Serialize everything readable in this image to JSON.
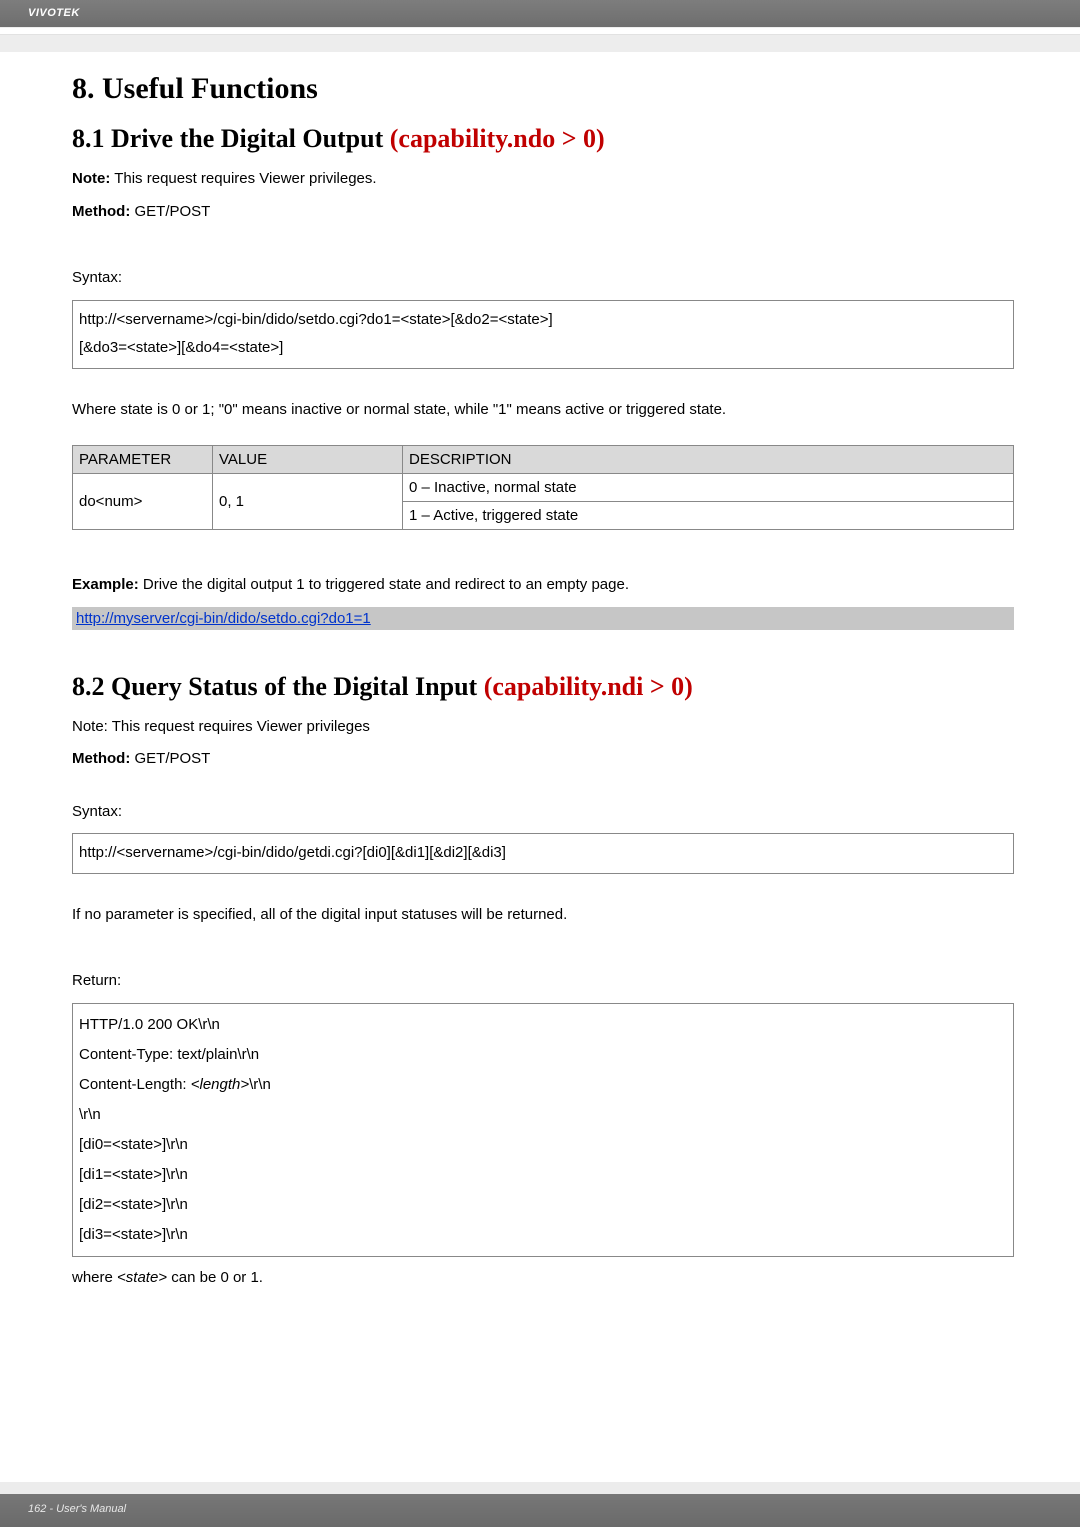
{
  "header": {
    "brand": "VIVOTEK"
  },
  "h1": "8. Useful Functions",
  "s81": {
    "title_plain": "8.1 Drive the Digital Output ",
    "title_cap": "(capability.ndo > 0)",
    "note_label": "Note:",
    "note_text": " This request requires Viewer privileges.",
    "method_label": "Method:",
    "method_text": " GET/POST",
    "syntax_label": "Syntax:",
    "syntax_lines": [
      "http://<servername>/cgi-bin/dido/setdo.cgi?do1=<state>[&do2=<state>]",
      "[&do3=<state>][&do4=<state>]"
    ],
    "where": "Where state is 0 or 1; \"0\" means inactive or normal state, while \"1\" means active or triggered state.",
    "cols": {
      "param": "PARAMETER",
      "value": "VALUE",
      "desc": "DESCRIPTION"
    },
    "rows": {
      "param": "do<num>",
      "value": "0, 1",
      "desc1": "0 – Inactive, normal state",
      "desc2": "1 – Active, triggered state"
    },
    "example_label": "Example:",
    "example_text": " Drive the digital output 1 to triggered state and redirect to an empty page.",
    "example_link": "http://myserver/cgi-bin/dido/setdo.cgi?do1=1"
  },
  "s82": {
    "title_plain": "8.2 Query Status of the Digital Input ",
    "title_cap": "(capability.ndi > 0)",
    "note": "Note: This request requires Viewer privileges",
    "method_label": "Method:",
    "method_text": " GET/POST",
    "syntax_label": "Syntax:",
    "syntax_line": "http://<servername>/cgi-bin/dido/getdi.cgi?[di0][&di1][&di2][&di3]",
    "noparam": "If no parameter is specified, all of the digital input statuses will be returned.",
    "return_label": "Return:",
    "return_lines": [
      "HTTP/1.0 200 OK\\r\\n",
      "Content-Type: text/plain\\r\\n",
      "Content-Length: <length>\\r\\n",
      "\\r\\n",
      "[di0=<state>]\\r\\n",
      "[di1=<state>]\\r\\n",
      "[di2=<state>]\\r\\n",
      "[di3=<state>]\\r\\n"
    ],
    "where": "where <state> can be 0 or 1."
  },
  "footer": {
    "text": "162 - User's Manual"
  }
}
